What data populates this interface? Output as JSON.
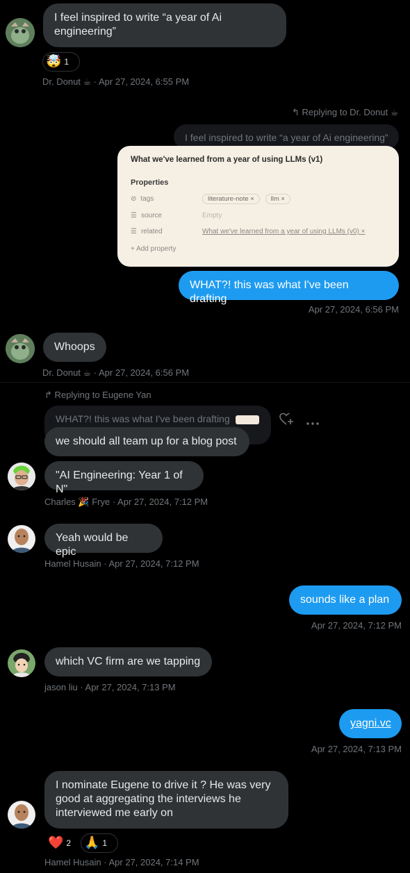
{
  "messages": {
    "m1": {
      "text": "I feel inspired to write “a year of Ai engineering”",
      "reaction_emoji": "🤯",
      "reaction_count": "1",
      "meta": "Dr. Donut ☕ · Apr 27, 2024, 6:55 PM"
    },
    "m2": {
      "reply_label": "Replying to Dr. Donut ☕",
      "quote": "I feel inspired to write “a year of Ai engineering”",
      "card": {
        "title": "What we've learned from a year of using LLMs (v1)",
        "properties_label": "Properties",
        "rows": [
          {
            "icon": "⊘",
            "key": "tags",
            "value_chips": [
              "literature-note ×",
              "llm ×"
            ]
          },
          {
            "icon": "☰",
            "key": "source",
            "value": "Empty"
          },
          {
            "icon": "☰",
            "key": "related",
            "value": "What we've learned from a year of using LLMs (v0) ×"
          }
        ],
        "add_property": "+ Add property"
      },
      "text": "WHAT?! this was what I've been drafting",
      "meta": "Apr 27, 2024, 6:56 PM"
    },
    "m3": {
      "text": "Whoops",
      "meta": "Dr. Donut ☕ · Apr 27, 2024, 6:56 PM"
    },
    "m4": {
      "reply_label": "Replying to Eugene Yan",
      "quote": "WHAT?! this was what I've been drafting",
      "text": "we should all team up for a blog post"
    },
    "m5": {
      "text": "\"AI Engineering: Year 1 of N\"",
      "meta": "Charles 🎉 Frye · Apr 27, 2024, 7:12 PM"
    },
    "m6": {
      "text": "Yeah would be epic",
      "meta": "Hamel Husain · Apr 27, 2024, 7:12 PM"
    },
    "m7": {
      "text": "sounds like a plan",
      "meta": "Apr 27, 2024, 7:12 PM"
    },
    "m8": {
      "text": "which VC firm are we tapping",
      "meta": "jason liu · Apr 27, 2024, 7:13 PM"
    },
    "m9": {
      "text": "yagni.vc",
      "meta": "Apr 27, 2024, 7:13 PM"
    },
    "m10": {
      "text": "I nominate Eugene to drive it ?  He was very good at aggregating the interviews he interviewed me early on",
      "reactions": [
        {
          "emoji": "❤️",
          "count": "2"
        },
        {
          "emoji": "🙏",
          "count": "1"
        }
      ],
      "meta": "Hamel Husain · Apr 27, 2024, 7:14 PM"
    }
  },
  "colors": {
    "background": "#000000",
    "incoming_bubble": "#2f3336",
    "outgoing_bubble": "#1d9bf0",
    "meta_text": "#71767b",
    "card_bg": "#f6f0e4"
  }
}
